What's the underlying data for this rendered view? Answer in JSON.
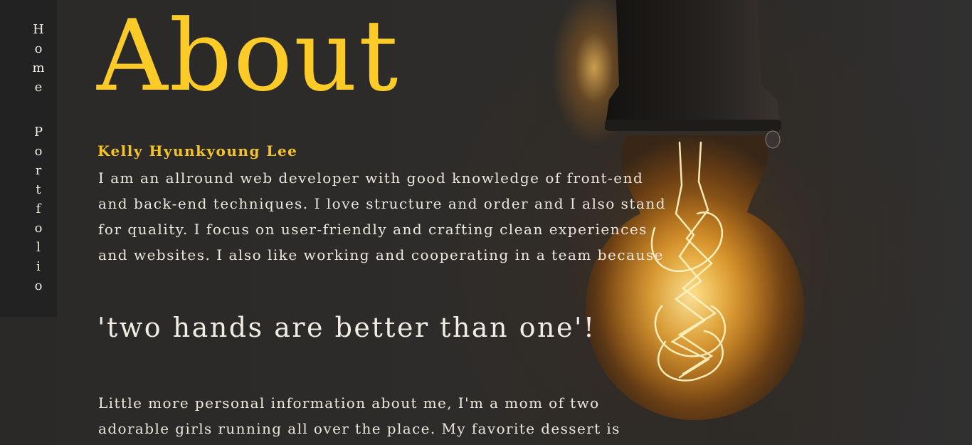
{
  "nav": {
    "home_label": "Home",
    "portfolio_label": "Portfolio"
  },
  "page": {
    "title": "About",
    "name": "Kelly Hyunkyoung Lee",
    "intro": "I am an allround web developer with good knowledge of front-end and back-end techniques. I love structure and order and I also stand for quality. I focus on user-friendly and crafting clean experiences and websites. I also like working and cooperating in a team because",
    "quote": "'two hands are better than one'!",
    "personal": "Little more personal information about me, I'm a mom of two adorable girls running all over the place. My favorite dessert is"
  },
  "colors": {
    "accent": "#fccb27",
    "text": "#ece7dc",
    "background": "#2b2a29"
  },
  "background_image": "light-bulb-photo"
}
